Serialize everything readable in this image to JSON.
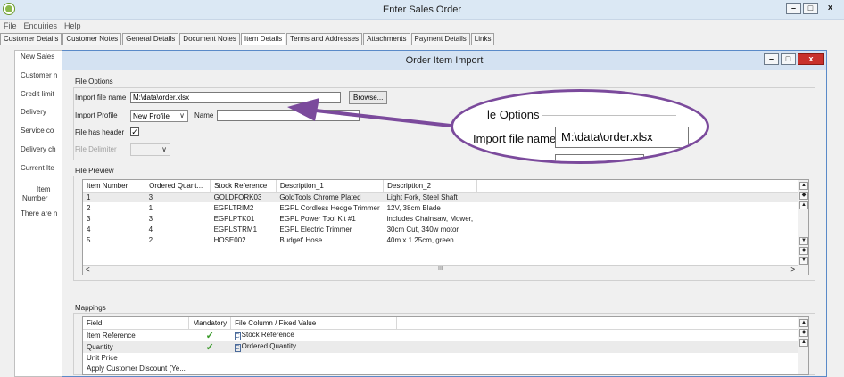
{
  "window": {
    "title": "Enter Sales Order"
  },
  "menu": [
    "File",
    "Enquiries",
    "Help"
  ],
  "tabs": [
    "Customer Details",
    "Customer Notes",
    "General Details",
    "Document Notes",
    "Item Details",
    "Terms and Addresses",
    "Attachments",
    "Payment Details",
    "Links"
  ],
  "left_panel": {
    "labels": [
      "New Sales",
      "Customer n",
      "Credit limit",
      "Delivery",
      "Service co",
      "Delivery ch",
      "Current Ite",
      "Item",
      "Number",
      "There are n"
    ]
  },
  "dialog": {
    "title": "Order Item Import",
    "file_options": {
      "group_label": "File Options",
      "import_file_label": "Import file name",
      "import_file_value": "M:\\data\\order.xlsx",
      "browse_label": "Browse...",
      "profile_label": "Import Profile",
      "profile_value": "New Profile",
      "name_label": "Name",
      "name_value": "",
      "has_header_label": "File has header",
      "has_header_checked": true,
      "delimiter_label": "File Delimiter",
      "delimiter_value": ""
    },
    "preview": {
      "group_label": "File Preview",
      "columns": [
        "Item Number",
        "Ordered Quant...",
        "Stock Reference",
        "Description_1",
        "Description_2"
      ],
      "rows": [
        [
          "1",
          "3",
          "GOLDFORK03",
          "GoldTools Chrome Plated",
          "Light Fork, Steel Shaft"
        ],
        [
          "2",
          "1",
          "EGPLTRIM2",
          "EGPL Cordless Hedge Trimmer",
          "12V, 38cm Blade"
        ],
        [
          "3",
          "3",
          "EGPLPTK01",
          "EGPL Power Tool Kit #1",
          "includes Chainsaw, Mower,"
        ],
        [
          "4",
          "4",
          "EGPLSTRM1",
          "EGPL Electric Trimmer",
          "30cm Cut, 340w motor"
        ],
        [
          "5",
          "2",
          "HOSE002",
          "Budget' Hose",
          "40m x 1.25cm, green"
        ]
      ],
      "hscroll_thumb": "III"
    },
    "mappings": {
      "group_label": "Mappings",
      "columns": [
        "Field",
        "Mandatory",
        "File Column / Fixed Value"
      ],
      "rows": [
        {
          "field": "Item Reference",
          "mandatory": "✓",
          "value": "Stock Reference"
        },
        {
          "field": "Quantity",
          "mandatory": "✓",
          "value": "Ordered Quantity"
        },
        {
          "field": "Unit Price",
          "mandatory": "",
          "value": ""
        },
        {
          "field": "Apply Customer Discount (Ye...",
          "mandatory": "",
          "value": ""
        }
      ]
    }
  },
  "callout": {
    "group_label": "le Options",
    "import_file_label": "Import file name",
    "import_file_value": "M:\\data\\order.xlsx"
  },
  "colors": {
    "callout_border": "#7b4a9c",
    "check": "#3a9a2a",
    "close_button": "#c8312c"
  }
}
